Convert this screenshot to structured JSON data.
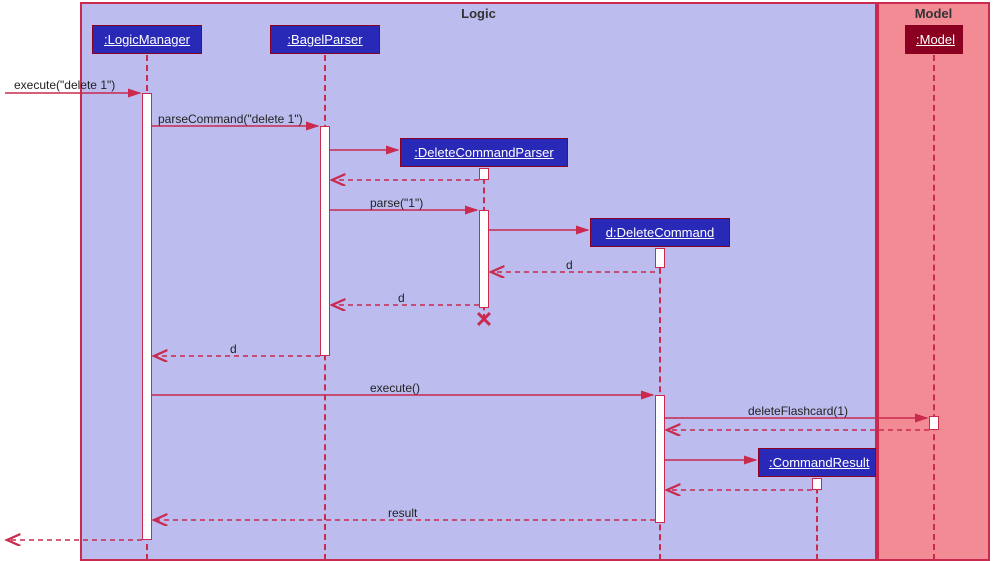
{
  "frames": {
    "logic": "Logic",
    "model": "Model"
  },
  "participants": {
    "logicManager": ":LogicManager",
    "bagelParser": ":BagelParser",
    "deleteCommandParser": ":DeleteCommandParser",
    "deleteCommand": "d:DeleteCommand",
    "commandResult": ":CommandResult",
    "model": ":Model"
  },
  "messages": {
    "execute1": "execute(\"delete 1\")",
    "parseCommand": "parseCommand(\"delete 1\")",
    "parse": "parse(\"1\")",
    "returnD1": "d",
    "returnD2": "d",
    "returnD3": "d",
    "executeCall": "execute()",
    "deleteFlashcard": "deleteFlashcard(1)",
    "result": "result"
  },
  "chart_data": {
    "type": "sequence-diagram",
    "frames": [
      "Logic",
      "Model"
    ],
    "lifelines": [
      {
        "name": ":LogicManager",
        "frame": "Logic"
      },
      {
        "name": ":BagelParser",
        "frame": "Logic"
      },
      {
        "name": ":DeleteCommandParser",
        "frame": "Logic",
        "created": true,
        "destroyed": true
      },
      {
        "name": "d:DeleteCommand",
        "frame": "Logic",
        "created": true
      },
      {
        "name": ":CommandResult",
        "frame": "Logic",
        "created": true
      },
      {
        "name": ":Model",
        "frame": "Model"
      }
    ],
    "messages": [
      {
        "from": "external",
        "to": ":LogicManager",
        "label": "execute(\"delete 1\")",
        "type": "sync"
      },
      {
        "from": ":LogicManager",
        "to": ":BagelParser",
        "label": "parseCommand(\"delete 1\")",
        "type": "sync"
      },
      {
        "from": ":BagelParser",
        "to": ":DeleteCommandParser",
        "label": "",
        "type": "create"
      },
      {
        "from": ":DeleteCommandParser",
        "to": ":BagelParser",
        "label": "",
        "type": "return"
      },
      {
        "from": ":BagelParser",
        "to": ":DeleteCommandParser",
        "label": "parse(\"1\")",
        "type": "sync"
      },
      {
        "from": ":DeleteCommandParser",
        "to": "d:DeleteCommand",
        "label": "",
        "type": "create"
      },
      {
        "from": "d:DeleteCommand",
        "to": ":DeleteCommandParser",
        "label": "d",
        "type": "return"
      },
      {
        "from": ":DeleteCommandParser",
        "to": ":BagelParser",
        "label": "d",
        "type": "return"
      },
      {
        "from": ":DeleteCommandParser",
        "to": null,
        "label": "",
        "type": "destroy"
      },
      {
        "from": ":BagelParser",
        "to": ":LogicManager",
        "label": "d",
        "type": "return"
      },
      {
        "from": ":LogicManager",
        "to": "d:DeleteCommand",
        "label": "execute()",
        "type": "sync"
      },
      {
        "from": "d:DeleteCommand",
        "to": ":Model",
        "label": "deleteFlashcard(1)",
        "type": "sync"
      },
      {
        "from": ":Model",
        "to": "d:DeleteCommand",
        "label": "",
        "type": "return"
      },
      {
        "from": "d:DeleteCommand",
        "to": ":CommandResult",
        "label": "",
        "type": "create"
      },
      {
        "from": ":CommandResult",
        "to": "d:DeleteCommand",
        "label": "",
        "type": "return"
      },
      {
        "from": "d:DeleteCommand",
        "to": ":LogicManager",
        "label": "result",
        "type": "return"
      },
      {
        "from": ":LogicManager",
        "to": "external",
        "label": "",
        "type": "return"
      }
    ]
  }
}
